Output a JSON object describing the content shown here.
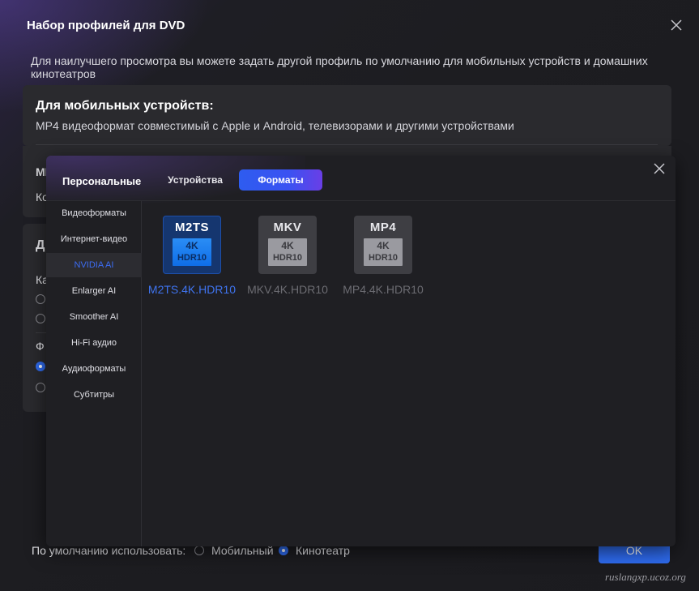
{
  "dialog": {
    "title": "Набор профилей для DVD",
    "description": "Для наилучшего просмотра вы можете задать другой профиль по умолчанию для мобильных устройств и домашних кинотеатров",
    "mobile_card": {
      "title": "Для мобильных устройств:",
      "subtitle": "MP4 видеоформат совместимый с Apple и Android, телевизорами и другими устройствами"
    },
    "partial_labels": {
      "card2_row1": "MI",
      "card2_row2": "Ко",
      "card3_title": "Д",
      "card3_row1": "Ка",
      "card3_row2": "Ф"
    },
    "footer": {
      "default_label": "По умолчанию использовать:",
      "option_mobile": "Мобильный",
      "option_theater": "Кинотеатр",
      "selected": "Кинотеатр"
    },
    "ok_label": "OK",
    "watermark": "ruslangxp.ucoz.org"
  },
  "panel": {
    "category": "Персональные",
    "tabs": [
      {
        "label": "Устройства",
        "active": false
      },
      {
        "label": "Форматы",
        "active": true
      }
    ],
    "sidebar": [
      {
        "label": "Видеоформаты",
        "active": false
      },
      {
        "label": "Интернет-видео",
        "active": false
      },
      {
        "label": "NVIDIA AI",
        "active": true
      },
      {
        "label": "Enlarger AI",
        "active": false
      },
      {
        "label": "Smoother AI",
        "active": false
      },
      {
        "label": "Hi-Fi аудио",
        "active": false
      },
      {
        "label": "Аудиоформаты",
        "active": false
      },
      {
        "label": "Субтитры",
        "active": false
      }
    ],
    "formats": [
      {
        "format": "M2TS",
        "badge_line1": "4K",
        "badge_line2": "HDR10",
        "name": "M2TS.4K.HDR10",
        "selected": true
      },
      {
        "format": "MKV",
        "badge_line1": "4K",
        "badge_line2": "HDR10",
        "name": "MKV.4K.HDR10",
        "selected": false
      },
      {
        "format": "MP4",
        "badge_line1": "4K",
        "badge_line2": "HDR10",
        "name": "MP4.4K.HDR10",
        "selected": false
      }
    ]
  },
  "colors": {
    "accent": "#2f6cf0",
    "active_text": "#3c6cf2",
    "tab_gradient_end": "#6a3ee6"
  }
}
